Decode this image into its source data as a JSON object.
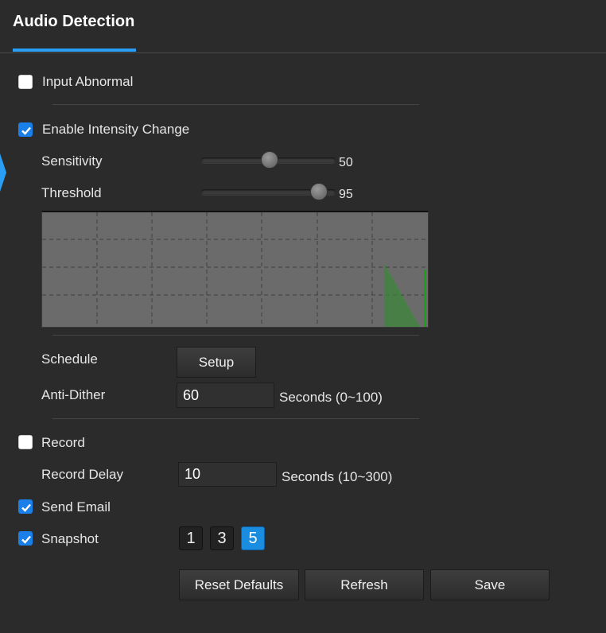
{
  "header": {
    "title": "Audio Detection"
  },
  "input_abnormal": {
    "label": "Input Abnormal",
    "checked": false
  },
  "intensity": {
    "label": "Enable Intensity Change",
    "checked": true,
    "sensitivity": {
      "label": "Sensitivity",
      "value": "50",
      "fraction": 0.5
    },
    "threshold": {
      "label": "Threshold",
      "value": "95",
      "fraction": 0.95
    }
  },
  "audio_graph": {
    "bars_note": "green level bars shown at right end",
    "colors": {
      "background": "#6b6b6b",
      "grid": "#444444",
      "bars": "#16a016"
    }
  },
  "schedule": {
    "label": "Schedule",
    "button": "Setup"
  },
  "anti_dither": {
    "label": "Anti-Dither",
    "value": "60",
    "unit": "Seconds (0~100)"
  },
  "record": {
    "label": "Record",
    "checked": false
  },
  "record_delay": {
    "label": "Record Delay",
    "value": "10",
    "unit": "Seconds (10~300)"
  },
  "send_email": {
    "label": "Send Email",
    "checked": true
  },
  "snapshot": {
    "label": "Snapshot",
    "checked": true,
    "options": [
      "1",
      "3",
      "5"
    ],
    "selected": "5"
  },
  "actions": {
    "reset": "Reset Defaults",
    "refresh": "Refresh",
    "save": "Save"
  },
  "colors": {
    "accent": "#2a9df4",
    "checkbox": "#1a7fe8",
    "background": "#2b2b2b"
  }
}
